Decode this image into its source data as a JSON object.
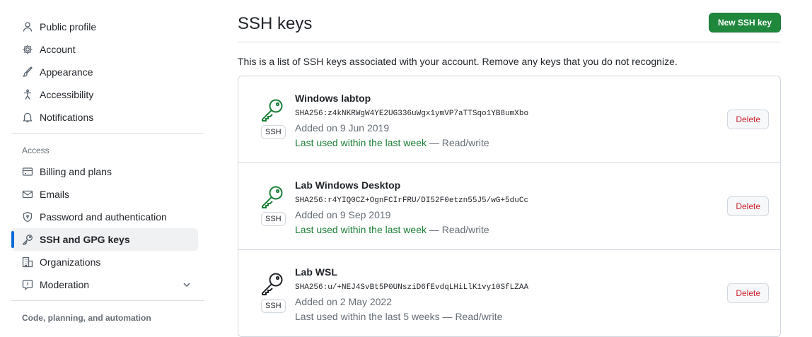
{
  "sidebar": {
    "items_top": [
      {
        "label": "Public profile",
        "icon": "person-icon"
      },
      {
        "label": "Account",
        "icon": "gear-icon"
      },
      {
        "label": "Appearance",
        "icon": "paintbrush-icon"
      },
      {
        "label": "Accessibility",
        "icon": "accessibility-icon"
      },
      {
        "label": "Notifications",
        "icon": "bell-icon"
      }
    ],
    "access_title": "Access",
    "items_access": [
      {
        "label": "Billing and plans",
        "icon": "credit-card-icon"
      },
      {
        "label": "Emails",
        "icon": "mail-icon"
      },
      {
        "label": "Password and authentication",
        "icon": "shield-lock-icon"
      },
      {
        "label": "SSH and GPG keys",
        "icon": "key-icon",
        "active": true
      },
      {
        "label": "Organizations",
        "icon": "organization-icon"
      },
      {
        "label": "Moderation",
        "icon": "report-icon"
      }
    ],
    "code_title": "Code, planning, and automation"
  },
  "main": {
    "title": "SSH keys",
    "new_button": "New SSH key",
    "description": "This is a list of SSH keys associated with your account. Remove any keys that you do not recognize.",
    "keys": [
      {
        "title": "Windows labtop",
        "fingerprint": "SHA256:z4kNKRWgW4YE2UG336uWgx1ymVP7aTTSqo1YB8umXbo",
        "added": "Added on 9 Jun 2019",
        "last_used": "Last used within the last week",
        "access": " — Read/write",
        "recent": true,
        "badge": "SSH",
        "delete": "Delete"
      },
      {
        "title": "Lab Windows Desktop",
        "fingerprint": "SHA256:r4YIQ0CZ+OgnFCIrFRU/DI52F0etzn55J5/wG+5duCc",
        "added": "Added on 9 Sep 2019",
        "last_used": "Last used within the last week",
        "access": " — Read/write",
        "recent": true,
        "badge": "SSH",
        "delete": "Delete"
      },
      {
        "title": "Lab WSL",
        "fingerprint": "SHA256:u/+NEJ4SvBt5P0UNsziD6fEvdqLHiLlK1vy10SfLZAA",
        "added": "Added on 2 May 2022",
        "last_used": "Last used within the last 5 weeks",
        "access": " — Read/write",
        "recent": false,
        "badge": "SSH",
        "delete": "Delete"
      }
    ]
  },
  "colors": {
    "accent": "#0969da",
    "primary_button": "#1f883d",
    "danger": "#cf222e",
    "recent_green": "#1a7f37"
  }
}
